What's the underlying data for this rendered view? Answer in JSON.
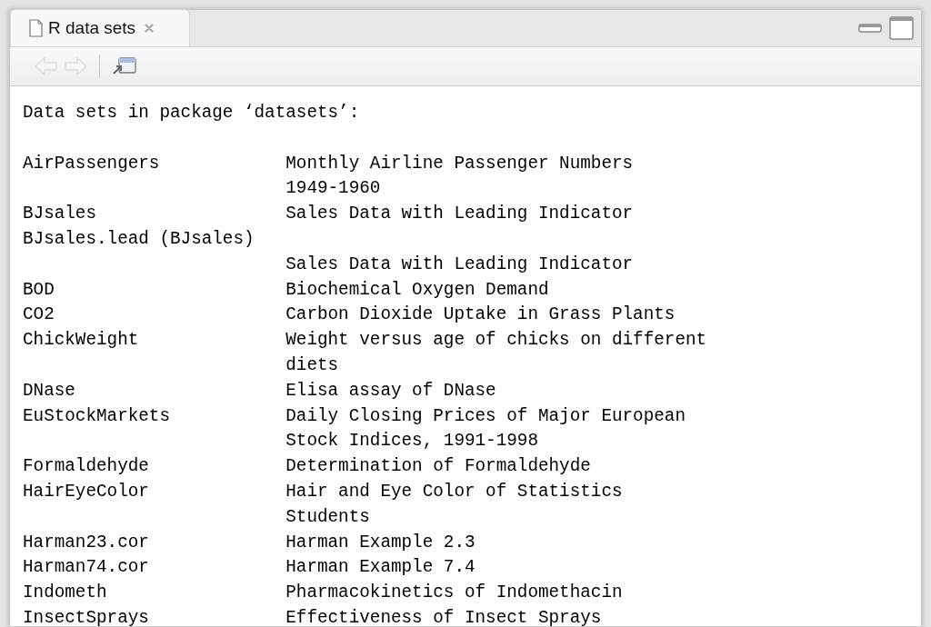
{
  "tabs": [
    {
      "label": "R data sets",
      "selected": true
    }
  ],
  "toolbar": {
    "back_disabled": true,
    "forward_disabled": true
  },
  "heading": "Data sets in package ‘datasets’:",
  "lines": [
    {
      "name": "AirPassengers",
      "description": "Monthly Airline Passenger Numbers"
    },
    {
      "description": "1949-1960"
    },
    {
      "name": "BJsales",
      "description": "Sales Data with Leading Indicator"
    },
    {
      "name": "BJsales.lead (BJsales)"
    },
    {
      "description": "Sales Data with Leading Indicator"
    },
    {
      "name": "BOD",
      "description": "Biochemical Oxygen Demand"
    },
    {
      "name": "CO2",
      "description": "Carbon Dioxide Uptake in Grass Plants"
    },
    {
      "name": "ChickWeight",
      "description": "Weight versus age of chicks on different"
    },
    {
      "description": "diets"
    },
    {
      "name": "DNase",
      "description": "Elisa assay of DNase"
    },
    {
      "name": "EuStockMarkets",
      "description": "Daily Closing Prices of Major European"
    },
    {
      "description": "Stock Indices, 1991-1998"
    },
    {
      "name": "Formaldehyde",
      "description": "Determination of Formaldehyde"
    },
    {
      "name": "HairEyeColor",
      "description": "Hair and Eye Color of Statistics"
    },
    {
      "description": "Students"
    },
    {
      "name": "Harman23.cor",
      "description": "Harman Example 2.3"
    },
    {
      "name": "Harman74.cor",
      "description": "Harman Example 7.4"
    },
    {
      "name": "Indometh",
      "description": "Pharmacokinetics of Indomethacin"
    },
    {
      "name": "InsectSprays",
      "description": "Effectiveness of Insect Sprays"
    }
  ]
}
